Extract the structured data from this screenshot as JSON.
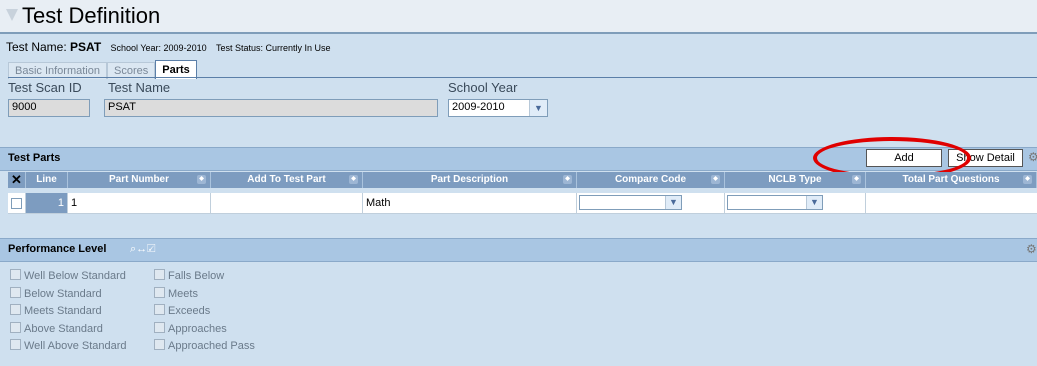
{
  "page": {
    "title": "Test Definition"
  },
  "info": {
    "test_name_label": "Test Name:",
    "test_name_value": "PSAT",
    "school_year_text": "School Year: 2009-2010",
    "test_status_text": "Test Status: Currently In Use"
  },
  "tabs": [
    {
      "label": "Basic Information",
      "active": false
    },
    {
      "label": "Scores",
      "active": false
    },
    {
      "label": "Parts",
      "active": true
    }
  ],
  "fields": {
    "scan_id": {
      "label": "Test Scan ID",
      "value": "9000"
    },
    "test_name": {
      "label": "Test Name",
      "value": "PSAT"
    },
    "school_year": {
      "label": "School Year",
      "value": "2009-2010"
    }
  },
  "test_parts": {
    "title": "Test Parts",
    "add_label": "Add",
    "show_detail_label": "Show Detail",
    "columns": [
      "Line",
      "Part Number",
      "Add To Test Part",
      "Part Description",
      "Compare Code",
      "NCLB Type",
      "Total Part Questions"
    ],
    "rows": [
      {
        "line": "1",
        "part_number": "1",
        "add_to_test_part": "",
        "part_description": "Math",
        "compare_code": "",
        "nclb_type": "",
        "total_part_questions": ""
      }
    ]
  },
  "performance": {
    "title": "Performance Level",
    "left": [
      "Well Below Standard",
      "Below Standard",
      "Meets Standard",
      "Above Standard",
      "Well Above Standard"
    ],
    "right": [
      "Falls Below",
      "Meets",
      "Exceeds",
      "Approaches",
      "Approached Pass"
    ]
  },
  "icons": {
    "close": "x-icon",
    "sort": "sort-icon",
    "dropdown": "chevron-down-icon",
    "settings": "gear-icon",
    "zoom": "magnifier-icon"
  },
  "colors": {
    "header_band": "#a9c6e3",
    "grid_header": "#7d9cc0",
    "highlight_ring": "#e00000"
  }
}
